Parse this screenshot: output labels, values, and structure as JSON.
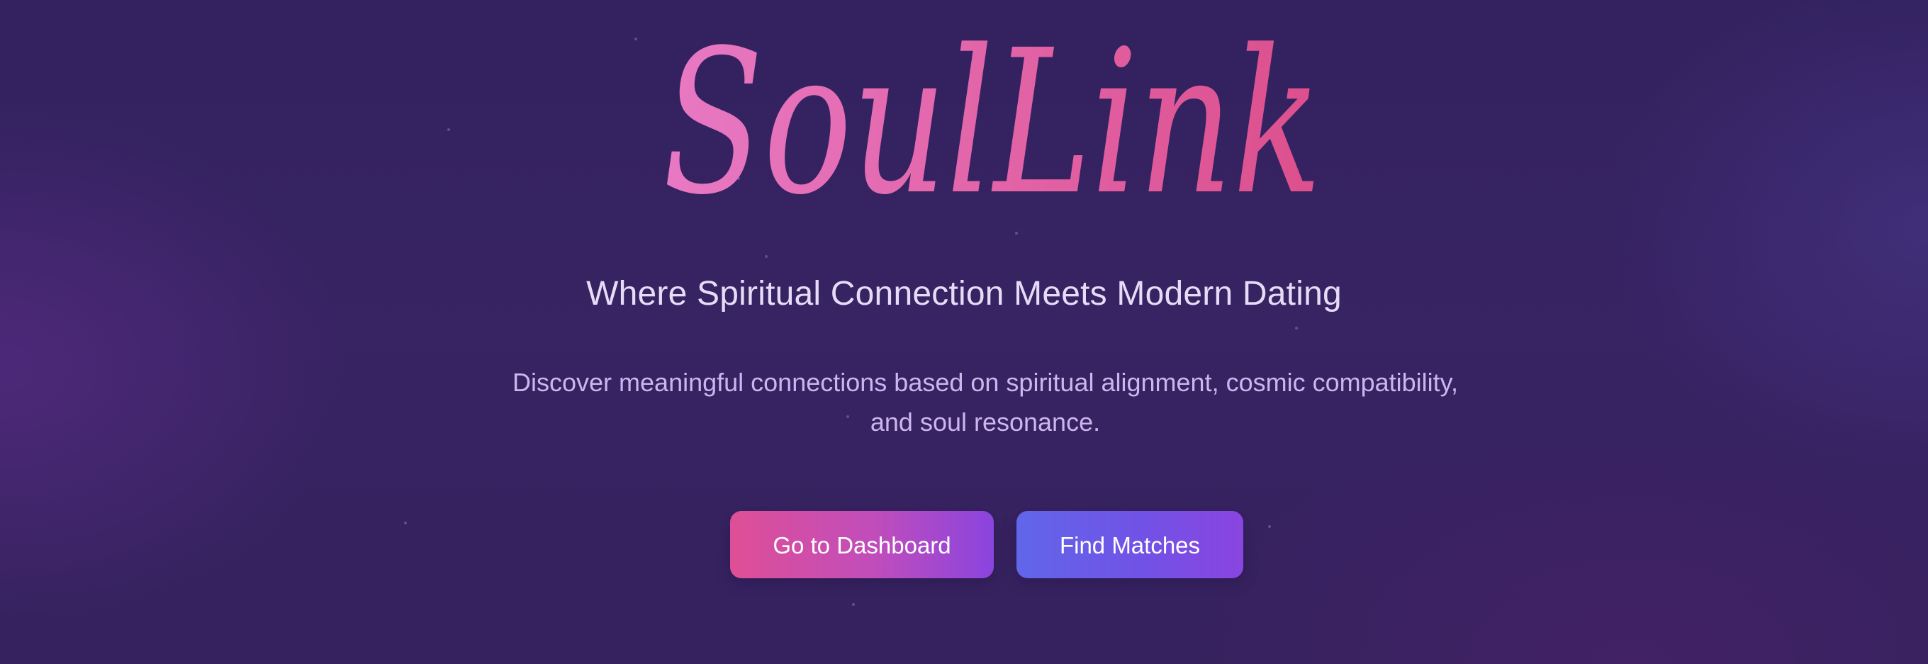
{
  "hero": {
    "logo_text": "SoulLink",
    "tagline": "Where Spiritual Connection Meets Modern Dating",
    "description": "Discover meaningful connections based on spiritual alignment, cosmic compatibility, and soul resonance."
  },
  "actions": {
    "dashboard_label": "Go to Dashboard",
    "matches_label": "Find Matches"
  },
  "colors": {
    "background": "#36225e",
    "logo_gradient_start": "#e879c4",
    "logo_gradient_end": "#dc4f8c",
    "tagline_text": "#e6dcf7",
    "description_text": "#cdb6ee",
    "dashboard_button_start": "#df4f96",
    "dashboard_button_end": "#8a44df",
    "matches_button_start": "#6166ea",
    "matches_button_end": "#8a45e0"
  }
}
